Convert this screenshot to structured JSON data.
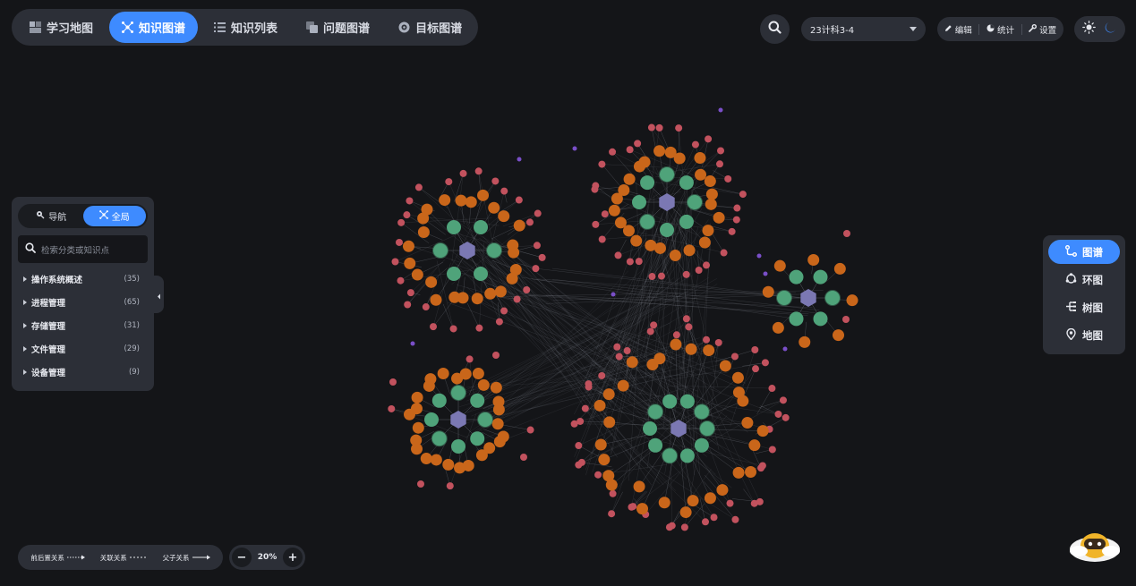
{
  "nav": {
    "tabs": [
      {
        "label": "学习地图",
        "icon": "map-icon",
        "active": false
      },
      {
        "label": "知识图谱",
        "icon": "graph-icon",
        "active": true
      },
      {
        "label": "知识列表",
        "icon": "list-icon",
        "active": false
      },
      {
        "label": "问题图谱",
        "icon": "question-icon",
        "active": false
      },
      {
        "label": "目标图谱",
        "icon": "target-icon",
        "active": false
      }
    ]
  },
  "toolbar": {
    "class_select": "23计科3-4",
    "edit_label": "编辑",
    "stats_label": "统计",
    "settings_label": "设置"
  },
  "sidebar": {
    "mode_nav": "导航",
    "mode_global": "全局",
    "search_placeholder": "检索分类或知识点",
    "categories": [
      {
        "label": "操作系统概述",
        "count": "(35)"
      },
      {
        "label": "进程管理",
        "count": "(65)"
      },
      {
        "label": "存储管理",
        "count": "(31)"
      },
      {
        "label": "文件管理",
        "count": "(29)"
      },
      {
        "label": "设备管理",
        "count": "(9)"
      }
    ]
  },
  "views": [
    {
      "label": "图谱",
      "icon": "graph-view-icon",
      "active": true
    },
    {
      "label": "环图",
      "icon": "ring-view-icon",
      "active": false
    },
    {
      "label": "树图",
      "icon": "tree-view-icon",
      "active": false
    },
    {
      "label": "地图",
      "icon": "location-icon",
      "active": false
    }
  ],
  "legend": {
    "prereq": "前后置关系",
    "related": "关联关系",
    "parent": "父子关系"
  },
  "zoom": {
    "level": "20%",
    "minus": "−",
    "plus": "+"
  },
  "colors": {
    "accent": "#3e8bff",
    "hub": "#7b78b3",
    "green": "#4fa37a",
    "orange": "#c9661a",
    "red": "#c2525e",
    "purple": "#7a4fc8"
  }
}
